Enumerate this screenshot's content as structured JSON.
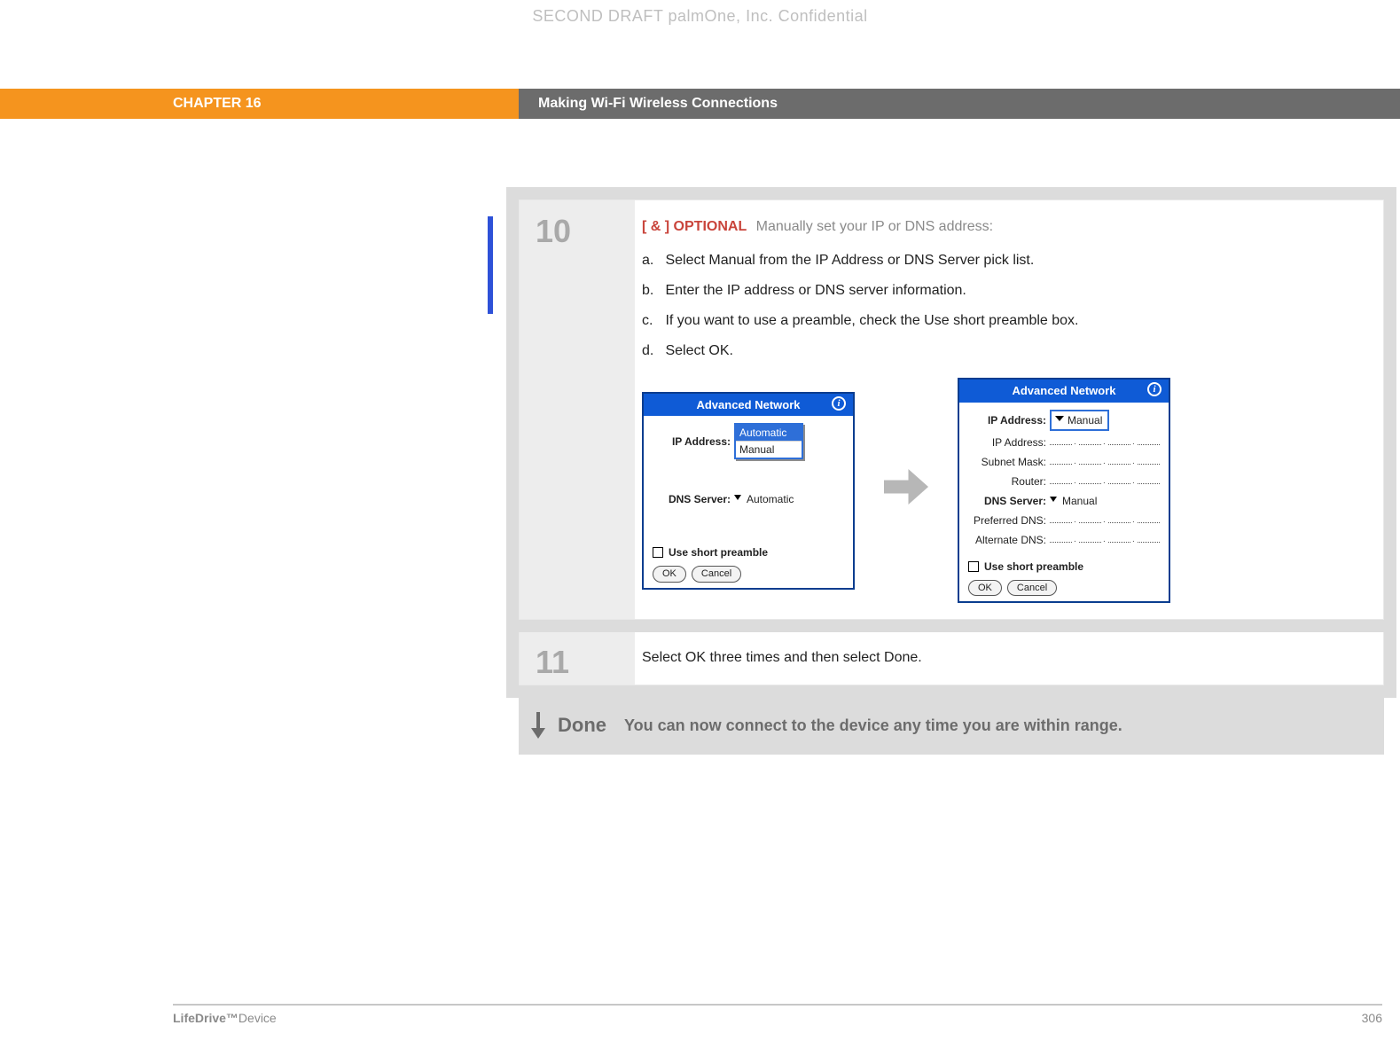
{
  "watermark": "SECOND DRAFT palmOne, Inc.  Confidential",
  "header": {
    "chapter": "CHAPTER 16",
    "title": "Making Wi-Fi Wireless Connections"
  },
  "steps": {
    "s10": {
      "num": "10",
      "optional_tag": "[ & ]  OPTIONAL",
      "optional_lead": "Manually set your IP or DNS address:",
      "items": {
        "a": {
          "letter": "a.",
          "text": "Select Manual from the IP Address or DNS Server pick list."
        },
        "b": {
          "letter": "b.",
          "text": "Enter the IP address or DNS server information."
        },
        "c": {
          "letter": "c.",
          "text": "If you want to use a preamble, check the Use short preamble box."
        },
        "d": {
          "letter": "d.",
          "text": "Select OK."
        }
      }
    },
    "s11": {
      "num": "11",
      "text": "Select OK three times and then select Done."
    }
  },
  "screens": {
    "title": "Advanced Network",
    "ip_label": "IP Address:",
    "dns_label": "DNS Server:",
    "automatic": "Automatic",
    "manual": "Manual",
    "ip_addr_label": "IP Address:",
    "subnet_label": "Subnet Mask:",
    "router_label": "Router:",
    "pref_dns_label": "Preferred DNS:",
    "alt_dns_label": "Alternate DNS:",
    "preamble": "Use short preamble",
    "ok": "OK",
    "cancel": "Cancel"
  },
  "done": {
    "label": "Done",
    "text": "You can now connect to the device any time you are within range."
  },
  "footer": {
    "brand_bold": "LifeDrive™",
    "brand_rest": "Device",
    "page": "306"
  }
}
